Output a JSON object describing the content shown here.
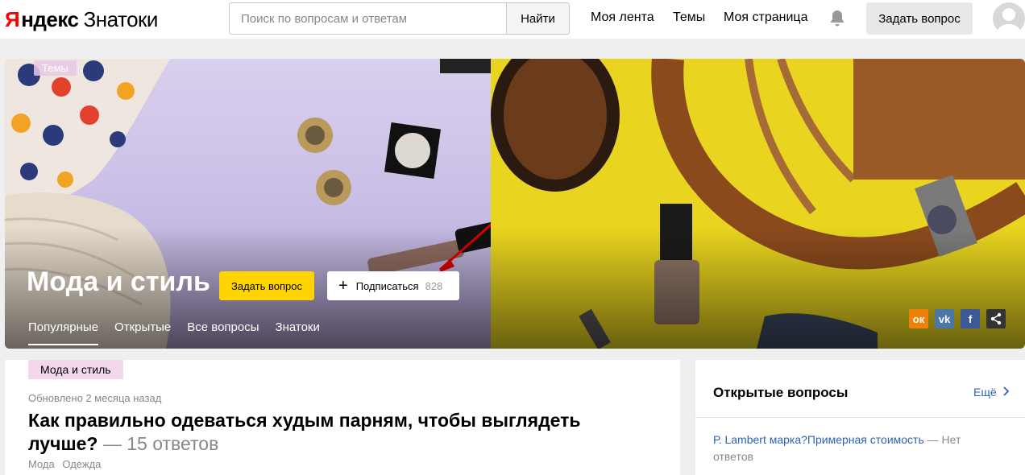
{
  "header": {
    "logo_ya": "Я",
    "logo_brand": "ндекс",
    "logo_product": "Знатоки",
    "search_placeholder": "Поиск по вопросам и ответам",
    "search_button": "Найти",
    "nav": [
      "Моя лента",
      "Темы",
      "Моя страница"
    ],
    "ask_button": "Задать вопрос"
  },
  "hero": {
    "tag": "Темы",
    "title": "Мода и стиль",
    "ask_button": "Задать вопрос",
    "subscribe_label": "Подписаться",
    "subscribe_count": "828",
    "tabs": [
      "Популярные",
      "Открытые",
      "Все вопросы",
      "Знатоки"
    ],
    "active_tab": "Популярные",
    "share": [
      {
        "name": "odnoklassniki-icon",
        "glyph": "ок",
        "color": "#ee8208"
      },
      {
        "name": "vk-icon",
        "glyph": "vk",
        "color": "#4a76a8"
      },
      {
        "name": "facebook-icon",
        "glyph": "f",
        "color": "#3b5998"
      },
      {
        "name": "share-icon",
        "glyph": "⤴",
        "color": "#333333"
      }
    ]
  },
  "question": {
    "chip": "Мода и стиль",
    "updated": "Обновлено 2 месяца назад",
    "title": "Как правильно одеваться худым парням, чтобы выглядеть лучше?",
    "answers": "— 15 ответов",
    "tags": [
      "Мода",
      "Одежда"
    ]
  },
  "sidebar": {
    "title": "Открытые вопросы",
    "more": "Ещё",
    "items": [
      {
        "question": "Р. Lambert марка?Примерная стоимость",
        "status": "— Нет ответов"
      }
    ]
  },
  "colors": {
    "accent": "#ffd400",
    "link": "#2b62b8",
    "logo_red": "#ff0000"
  }
}
